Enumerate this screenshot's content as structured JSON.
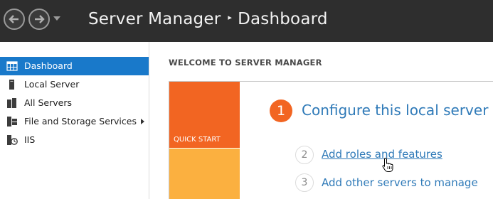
{
  "window": {
    "title_app": "Server Manager",
    "title_separator": "▸",
    "title_page": "Dashboard"
  },
  "sidebar": {
    "items": [
      {
        "label": "Dashboard",
        "icon": "dashboard-icon",
        "active": true
      },
      {
        "label": "Local Server",
        "icon": "server-icon"
      },
      {
        "label": "All Servers",
        "icon": "servers-icon"
      },
      {
        "label": "File and Storage Services",
        "icon": "storage-icon",
        "has_arrow": true
      },
      {
        "label": "IIS",
        "icon": "iis-icon"
      }
    ]
  },
  "main": {
    "heading": "WELCOME TO SERVER MANAGER",
    "quick_start_label": "QUICK START",
    "steps": [
      {
        "number": "1",
        "label": "Configure this local server"
      },
      {
        "number": "2",
        "label": "Add roles and features"
      },
      {
        "number": "3",
        "label": "Add other servers to manage"
      }
    ]
  },
  "colors": {
    "titlebar": "#2e2e2e",
    "active_item": "#1979ca",
    "orange_tile": "#f26522",
    "yellow_tile": "#fbb040",
    "link": "#2f7ab8"
  }
}
